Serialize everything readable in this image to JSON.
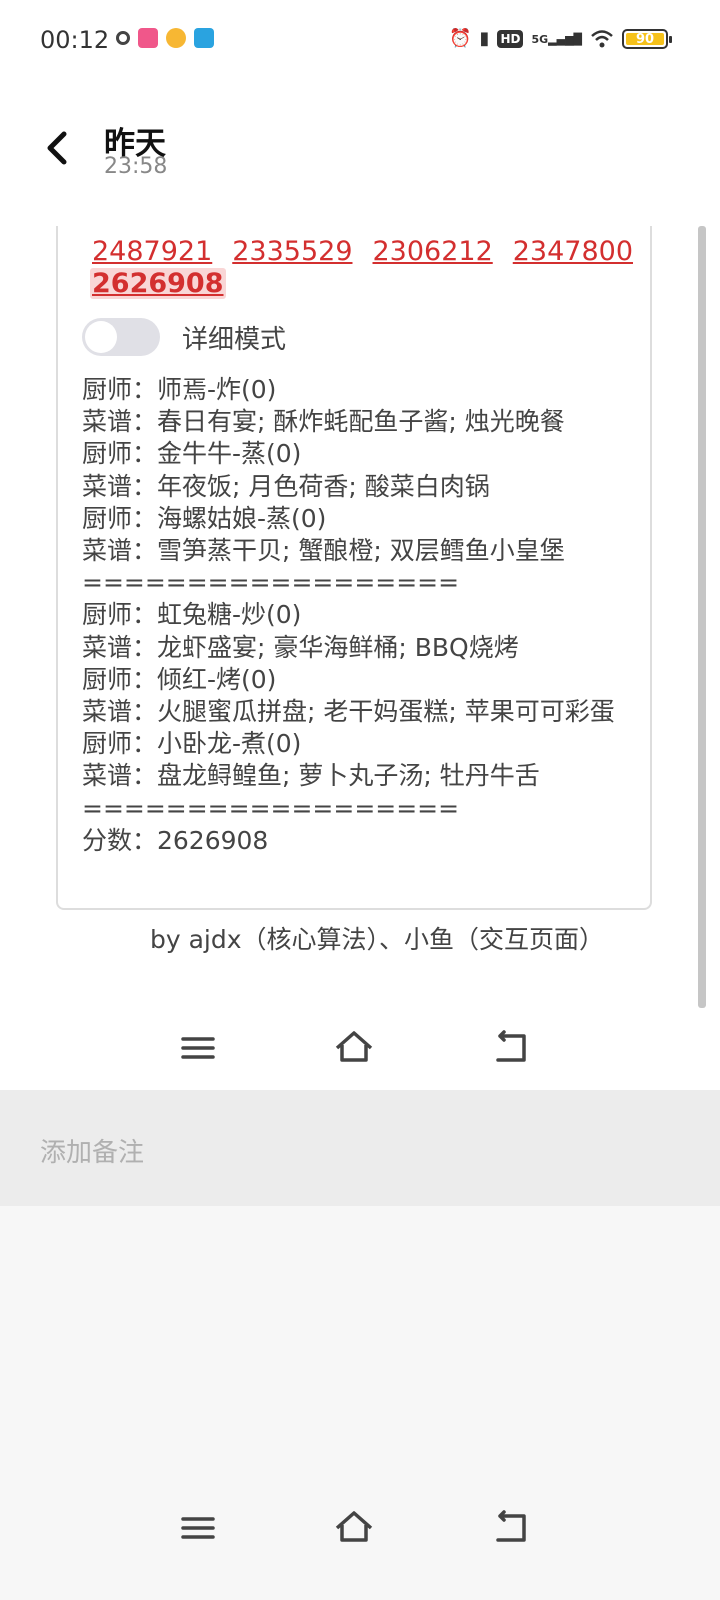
{
  "status_bar": {
    "time": "00:12",
    "network": "5G",
    "hd": "HD",
    "battery": "90",
    "icons_left": [
      "circle-icon",
      "app-icon-pink",
      "weibo-icon",
      "telegram-icon"
    ],
    "icons_right": [
      "alarm-icon",
      "vibrate-icon",
      "hd-icon",
      "signal-icon",
      "wifi-icon",
      "battery-icon"
    ]
  },
  "header": {
    "title": "昨天",
    "subtitle": "23:58"
  },
  "card": {
    "numbers_row1": [
      "2487921",
      "2335529",
      "2306212",
      "2347800"
    ],
    "numbers_row2": [
      "2626908"
    ],
    "toggle_label": "详细模式",
    "toggle_on": false,
    "lines": [
      "厨师：师焉-炸(0)",
      "菜谱：春日有宴; 酥炸蚝配鱼子酱; 烛光晚餐",
      "厨师：金牛牛-蒸(0)",
      "菜谱：年夜饭; 月色荷香; 酸菜白肉锅",
      "厨师：海螺姑娘-蒸(0)",
      "菜谱：雪笋蒸干贝; 蟹酿橙; 双层鳕鱼小皇堡",
      "==================",
      "厨师：虹兔糖-炒(0)",
      "菜谱：龙虾盛宴; 豪华海鲜桶; BBQ烧烤",
      "厨师：倾红-烤(0)",
      "菜谱：火腿蜜瓜拼盘; 老干妈蛋糕; 苹果可可彩蛋",
      "厨师：小卧龙-煮(0)",
      "菜谱：盘龙鲟鳇鱼; 萝卜丸子汤; 牡丹牛舌",
      "==================",
      "分数：2626908"
    ]
  },
  "credit": "by ajdx（核心算法）、小鱼（交互页面）",
  "note": {
    "placeholder": "添加备注"
  },
  "colors": {
    "link_red": "#d32f2f",
    "battery_yellow": "#f6c21b"
  }
}
